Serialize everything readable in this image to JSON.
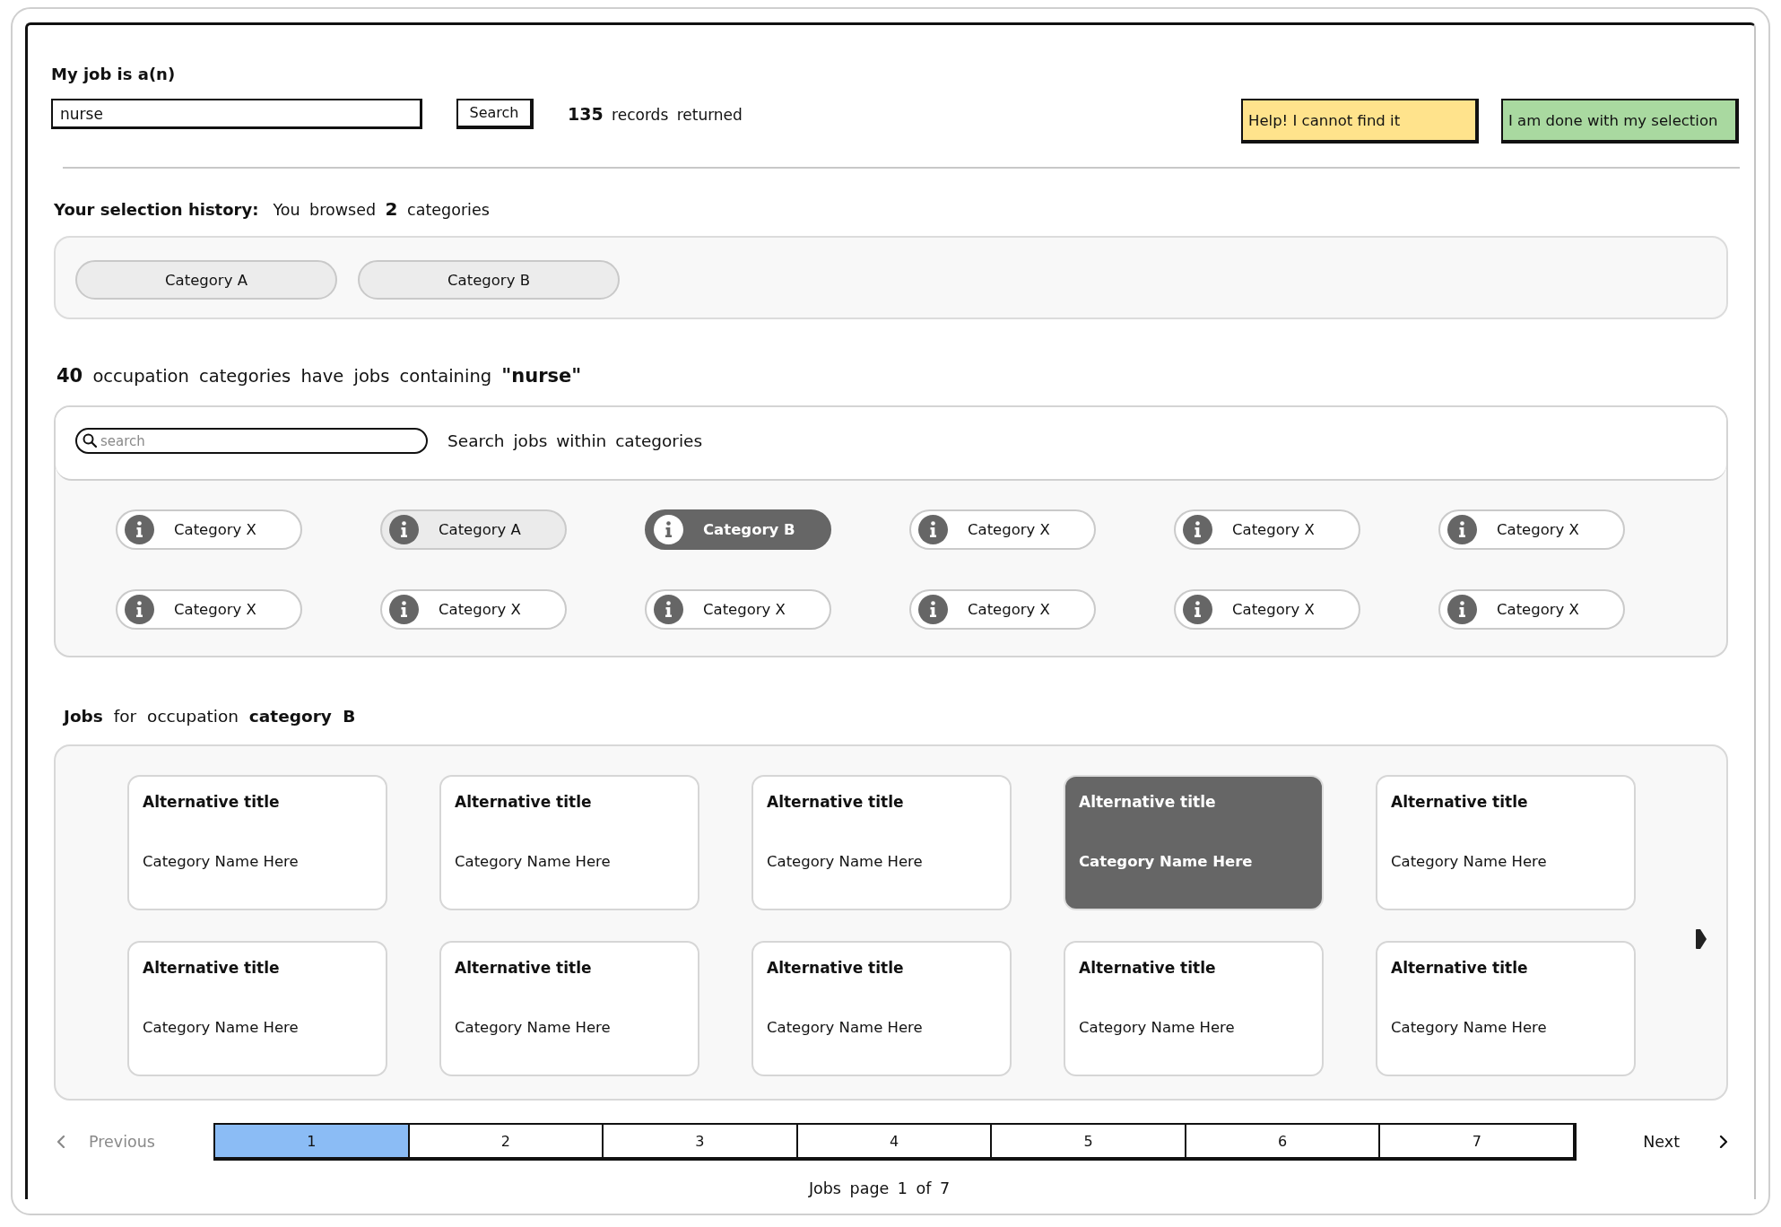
{
  "job_search": {
    "label": "My job is a(n)",
    "value": "nurse",
    "button": "Search",
    "result": "**135** records returned"
  },
  "actions": [
    {
      "kind": "help",
      "label": "Help! I cannot find it"
    },
    {
      "kind": "done",
      "label": "I am done with my selection"
    }
  ],
  "history": {
    "title": "Your selection history:",
    "summary": "You browsed **2** categories",
    "items": [
      "Category A",
      "Category B"
    ]
  },
  "categories": {
    "heading": "**40** occupation categories have jobs containing **\"nurse\"**",
    "search": {
      "placeholder": "search"
    },
    "search_hint": "Search jobs within categories",
    "items": [
      {
        "label": "Category X",
        "selected": false,
        "visited": false
      },
      {
        "label": "Category A",
        "selected": false,
        "visited": true
      },
      {
        "label": "Category B",
        "selected": true,
        "visited": true
      },
      {
        "label": "Category X",
        "selected": false,
        "visited": false
      },
      {
        "label": "Category X",
        "selected": false,
        "visited": false
      },
      {
        "label": "Category X",
        "selected": false,
        "visited": false
      },
      {
        "label": "Category X",
        "selected": false,
        "visited": false
      },
      {
        "label": "Category X",
        "selected": false,
        "visited": false
      },
      {
        "label": "Category X",
        "selected": false,
        "visited": false
      },
      {
        "label": "Category X",
        "selected": false,
        "visited": false
      },
      {
        "label": "Category X",
        "selected": false,
        "visited": false
      },
      {
        "label": "Category X",
        "selected": false,
        "visited": false
      }
    ]
  },
  "jobs": {
    "heading": "**Jobs** for occupation **category B**",
    "cards": [
      {
        "title": "Alternative title",
        "category": "Category Name Here",
        "selected": false
      },
      {
        "title": "Alternative title",
        "category": "Category Name Here",
        "selected": false
      },
      {
        "title": "Alternative title",
        "category": "Category Name Here",
        "selected": false
      },
      {
        "title": "Alternative title",
        "category": "Category Name Here",
        "selected": true
      },
      {
        "title": "Alternative title",
        "category": "Category Name Here",
        "selected": false
      },
      {
        "title": "Alternative title",
        "category": "Category Name Here",
        "selected": false
      },
      {
        "title": "Alternative title",
        "category": "Category Name Here",
        "selected": false
      },
      {
        "title": "Alternative title",
        "category": "Category Name Here",
        "selected": false
      },
      {
        "title": "Alternative title",
        "category": "Category Name Here",
        "selected": false
      },
      {
        "title": "Alternative title",
        "category": "Category Name Here",
        "selected": false
      }
    ]
  },
  "pagination": {
    "previous": {
      "label": "Previous",
      "disabled": true
    },
    "pages": [
      {
        "label": "1",
        "selected": true
      },
      {
        "label": "2",
        "selected": false
      },
      {
        "label": "3",
        "selected": false
      },
      {
        "label": "4",
        "selected": false
      },
      {
        "label": "5",
        "selected": false
      },
      {
        "label": "6",
        "selected": false
      },
      {
        "label": "7",
        "selected": false
      }
    ],
    "next": {
      "label": "Next",
      "disabled": false
    },
    "status": "Jobs page 1 of 7"
  }
}
